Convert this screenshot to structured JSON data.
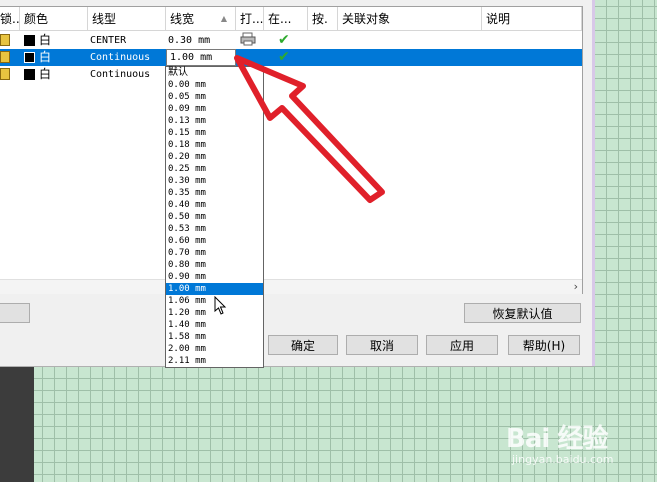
{
  "table": {
    "headers": {
      "lock": "锁...",
      "color": "颜色",
      "linetype": "线型",
      "lineweight": "线宽",
      "sort_icon": "sort-up-icon",
      "plot": "打...",
      "in_use": "在...",
      "press": "按.",
      "related": "关联对象",
      "description": "说明"
    },
    "rows": [
      {
        "color": "白",
        "linetype": "CENTER",
        "lineweight": "0.30 mm"
      },
      {
        "color": "白",
        "linetype": "Continuous",
        "lineweight": "1.00 mm"
      },
      {
        "color": "白",
        "linetype": "Continuous",
        "lineweight": ""
      }
    ],
    "scroll_right": "›"
  },
  "dropdown": {
    "current": "1.00 mm",
    "options": [
      "默认",
      "0.00 mm",
      "0.05 mm",
      "0.09 mm",
      "0.13 mm",
      "0.15 mm",
      "0.18 mm",
      "0.20 mm",
      "0.25 mm",
      "0.30 mm",
      "0.35 mm",
      "0.40 mm",
      "0.50 mm",
      "0.53 mm",
      "0.60 mm",
      "0.70 mm",
      "0.80 mm",
      "0.90 mm",
      "1.00 mm",
      "1.06 mm",
      "1.20 mm",
      "1.40 mm",
      "1.58 mm",
      "2.00 mm",
      "2.11 mm"
    ],
    "selected_index": 18
  },
  "buttons": {
    "restore_defaults": "恢复默认值",
    "ok": "确定",
    "cancel": "取消",
    "apply": "应用",
    "help": "帮助(H)"
  },
  "watermark": {
    "logo": "Bai 经验",
    "url": "jingyan.baidu.com"
  },
  "colors": {
    "selection": "#0078d7",
    "annotation_arrow": "#e0202a",
    "check": "#2eaa2e"
  }
}
